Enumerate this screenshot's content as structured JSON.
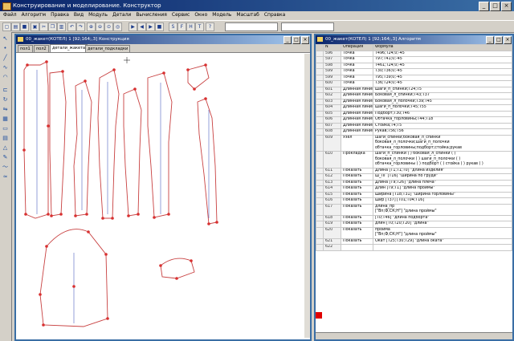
{
  "app": {
    "title": "Конструирование и моделирование. Конструктор"
  },
  "menu": [
    "Файл",
    "Алгоритм",
    "Правка",
    "Вид",
    "Модуль",
    "Детали",
    "Вычисления",
    "Сервис",
    "Окно",
    "Модель",
    "Масштаб",
    "Справка"
  ],
  "pattern_window": {
    "title": "00_жакет(КОТЕЛ) 1 [92;164;,3] Конструкция",
    "tabs": [
      "пол1",
      "пол2",
      "детали_жакета",
      "детали_подкладки"
    ],
    "active_tab": 2
  },
  "formula_window": {
    "title": "00_жакет(КОТЕЛ) 1 [92;164;,3] Алгоритм",
    "col_headers": [
      "N",
      "Операция",
      "Формула"
    ],
    "rows": [
      [
        "596",
        "Точка",
        "Т496;Т24;0;-45"
      ],
      [
        "597",
        "Точка",
        "Т97;Т41;0;-45"
      ],
      [
        "598",
        "Точка",
        "Т461;Т24;0;-45"
      ],
      [
        "599",
        "Точка",
        "Т30;Т36;0;-45"
      ],
      [
        "599",
        "Точка",
        "Т95;Т39;0;-45"
      ],
      [
        "600",
        "Точка",
        "Т36;Т24;0;-45"
      ],
      [
        "601",
        "Длинная линия",
        "Шаги_п_спинки;Т24;Т5"
      ],
      [
        "602",
        "Длинная линия",
        "Боковая_л_спинки;Т43;Т37"
      ],
      [
        "603",
        "Длинная линия",
        "Боковая_л_полочки;Т39;Т45"
      ],
      [
        "604",
        "Длинная линия",
        "Шаги_п_полочки;Т45;Т55"
      ],
      [
        "605",
        "Длинная линия",
        "Подборт;Т30;Т46"
      ],
      [
        "606",
        "Длинная линия",
        "Обтачка_горловины;Т44;Т18"
      ],
      [
        "607",
        "Длинная линия",
        "Стойка;Т4;Т5"
      ],
      [
        "608",
        "Длинная линия",
        "Рукав;Т56;Т56"
      ],
      [
        "609",
        "Узел",
        "шаги_спинки;боковая_л_спинки\nбоковая_л_полочки;шаги_п_полочки\nобтачка_горловины;подборт;стойка;рукав"
      ],
      [
        "610",
        "Прокладка",
        "шаги_п_спинки ( ) боковая_л_спинки ( )\nбоковая_л_полочки ( ) шаги_п_полочки ( )\nобтачка_горловины ( ) подборт ( ) стойка ( ) рукав ( )"
      ],
      [
        "611",
        "Показать",
        "Длина [Т1;Т1;Т0] \"длина изделия\""
      ],
      [
        "612",
        "Показать",
        "Ш_ПГ [Т16] \"ширина по груди\""
      ],
      [
        "613",
        "Показать",
        "Длина [Т9;Т26] \"длина плеча\""
      ],
      [
        "614",
        "Показать",
        "Длин [Т9;Т1] \"длина проймы\""
      ],
      [
        "615",
        "Показать",
        "Ширина [Т18;Т31] \"ширина горловины\""
      ],
      [
        "616",
        "Показать",
        "Шир [Т37] [Т01;Т04;Т16]"
      ],
      [
        "617",
        "Показать",
        "длина_пр\n[\"Вп;Ф;СК;Н\"] \"длина проймы\""
      ],
      [
        "618",
        "Показать",
        "[Т0;Т46] \"длина подборта\""
      ],
      [
        "619",
        "Показать",
        "длин [Т0;Т20;Т20] \"длина\""
      ],
      [
        "620",
        "Показать",
        "пройма\n[\"Вп;Ф;СК;Н\"] \"длина проймы\""
      ],
      [
        "621",
        "Показать",
        "Окат [Т25;Т30;Т29] \"длина оката\""
      ],
      [
        "622",
        "",
        ""
      ]
    ]
  },
  "toolbar": {
    "combo1": "",
    "combo2": ""
  },
  "colors": {
    "pattern_line": "#c84040",
    "pattern_point": "#d83030",
    "title_bar": "#0a246a"
  },
  "icons": [
    "new-file-icon",
    "open-icon",
    "save-icon",
    "print-icon",
    "cut-icon",
    "copy-icon",
    "paste-icon",
    "undo-icon",
    "redo-icon",
    "zoom-in-icon",
    "zoom-out-icon",
    "zoom-fit-icon",
    "play-icon",
    "step-back-icon",
    "step-forward-icon",
    "stop-icon",
    "bold-icon",
    "italic-icon",
    "underline-icon",
    "text-icon",
    "help-icon"
  ]
}
